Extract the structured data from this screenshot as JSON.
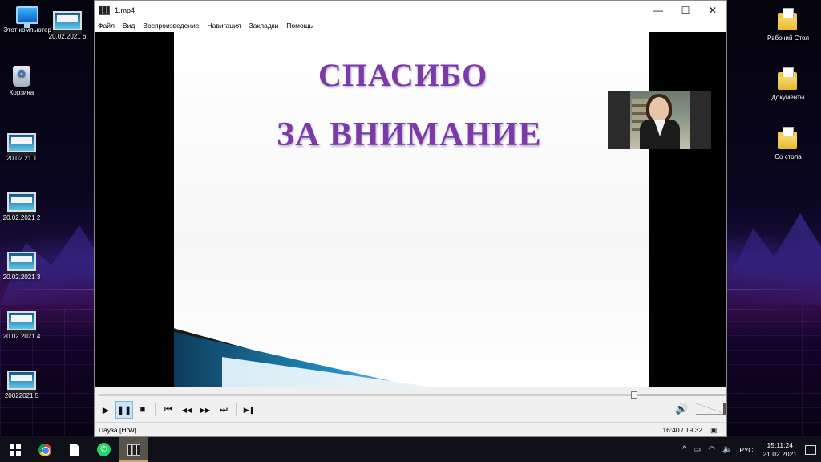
{
  "desktop": {
    "left_icons": [
      {
        "label": "Этот компьютер"
      },
      {
        "label": "20.02.2021 6"
      },
      {
        "label": "Корзина"
      },
      {
        "label": "20.02.21 1"
      },
      {
        "label": "20.02.2021 2"
      },
      {
        "label": "20.02.2021 3"
      },
      {
        "label": "20.02.2021 4"
      },
      {
        "label": "20022021 5"
      }
    ],
    "right_icons": [
      {
        "label": "Рабочий Стол"
      },
      {
        "label": "Документы"
      },
      {
        "label": "Со стола"
      }
    ]
  },
  "player": {
    "title": "1.mp4",
    "window_controls": {
      "minimize": "—",
      "maximize": "☐",
      "close": "✕"
    },
    "menu": [
      "Файл",
      "Вид",
      "Воспроизведение",
      "Навигация",
      "Закладки",
      "Помощь"
    ],
    "slide": {
      "line1": "СПАСИБО",
      "line2": "ЗА ВНИМАНИЕ"
    },
    "seek_progress": 0.858,
    "controls": {
      "play": "▶",
      "pause": "❚❚",
      "stop": "■",
      "prev": "⏮",
      "rewind": "◀◀",
      "forward": "▶▶",
      "next": "⏭",
      "frame_step": "▶❚",
      "volume": "🔊",
      "volume_level": 1.0
    },
    "status": {
      "state": "Пауза [H/W]",
      "time": "16:40 / 19:32"
    }
  },
  "taskbar": {
    "tray": {
      "chevron": "^",
      "language": "РУС",
      "time": "15:11:24",
      "date": "21.02.2021"
    }
  },
  "colors": {
    "slide_title": "#7a3aa8",
    "taskbar": "#101018",
    "active_control": "#cde4f7"
  }
}
